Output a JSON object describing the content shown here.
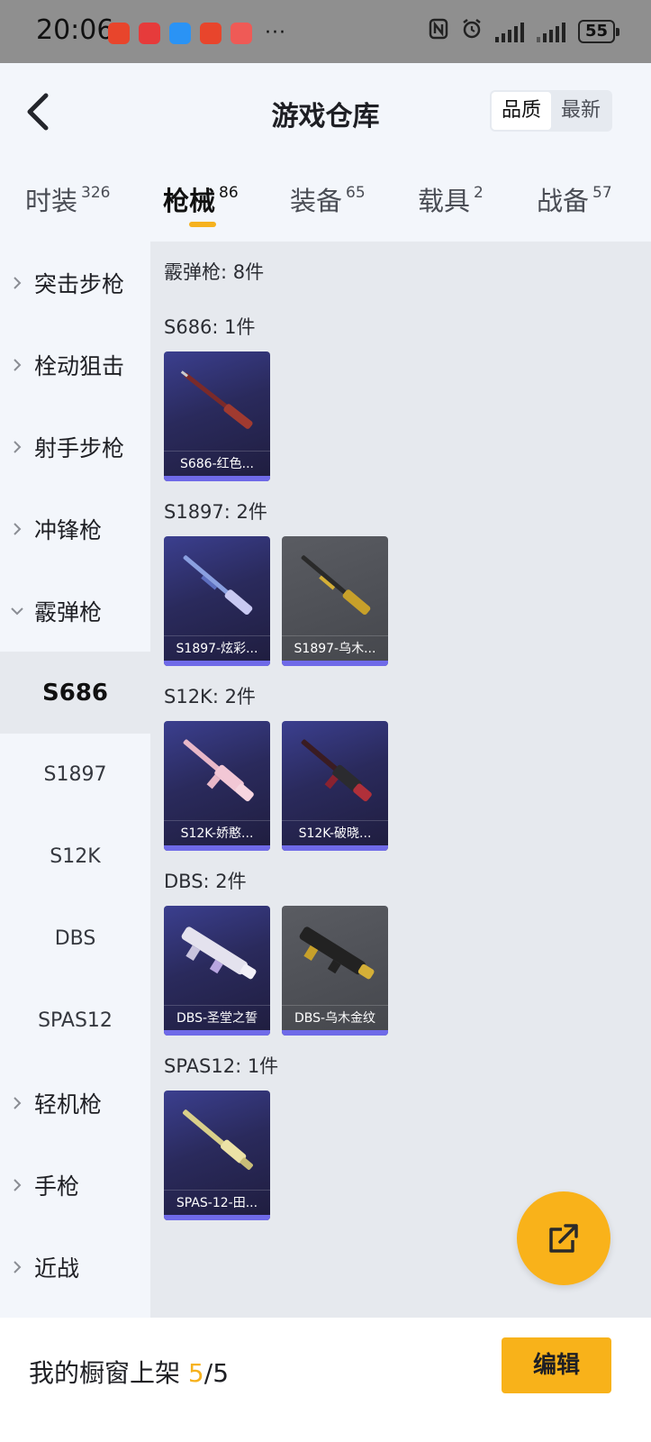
{
  "status_bar": {
    "time": "20:06",
    "dots": "···",
    "battery": "55"
  },
  "header": {
    "title": "游戏仓库",
    "sort_options": [
      "品质",
      "最新"
    ],
    "active_sort": "品质"
  },
  "tabs": [
    {
      "label": "时装",
      "count": "326"
    },
    {
      "label": "枪械",
      "count": "86",
      "active": true
    },
    {
      "label": "装备",
      "count": "65"
    },
    {
      "label": "载具",
      "count": "2"
    },
    {
      "label": "战备",
      "count": "57"
    }
  ],
  "sidebar": {
    "categories": [
      "突击步枪",
      "栓动狙击",
      "射手步枪",
      "冲锋枪",
      "霰弹枪"
    ],
    "subcategories": [
      "S686",
      "S1897",
      "S12K",
      "DBS",
      "SPAS12"
    ],
    "active_subcategory": "S686",
    "more_categories": [
      "轻机枪",
      "手枪",
      "近战"
    ]
  },
  "content": {
    "group_title": "霰弹枪: 8件",
    "sections": [
      {
        "title": "S686: 1件",
        "items": [
          {
            "name": "S686-红色...",
            "rarity": "purple"
          }
        ]
      },
      {
        "title": "S1897: 2件",
        "items": [
          {
            "name": "S1897-炫彩...",
            "rarity": "purple"
          },
          {
            "name": "S1897-乌木...",
            "rarity": "gray"
          }
        ]
      },
      {
        "title": "S12K: 2件",
        "items": [
          {
            "name": "S12K-娇憨...",
            "rarity": "purple"
          },
          {
            "name": "S12K-破晓...",
            "rarity": "purple"
          }
        ]
      },
      {
        "title": "DBS: 2件",
        "items": [
          {
            "name": "DBS-圣堂之誓",
            "rarity": "purple"
          },
          {
            "name": "DBS-乌木金纹",
            "rarity": "gray"
          }
        ]
      },
      {
        "title": "SPAS12: 1件",
        "items": [
          {
            "name": "SPAS-12-田...",
            "rarity": "purple"
          }
        ]
      }
    ]
  },
  "bottom_bar": {
    "label": "我的橱窗上架",
    "count": "5",
    "separator": "/",
    "total": "5",
    "edit_label": "编辑"
  },
  "colors": {
    "accent": "#f8b21a",
    "purple_card": "#2e2d66",
    "gray_card": "#515358",
    "rarity_bar": "#6f6ae8"
  },
  "icons": [
    "back-arrow-icon",
    "chevron-right-icon",
    "chevron-down-icon",
    "share-icon"
  ]
}
